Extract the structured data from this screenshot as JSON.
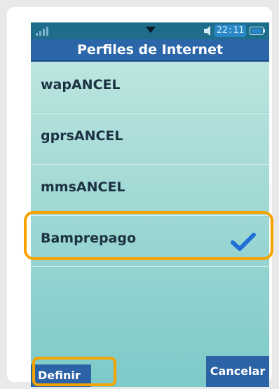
{
  "status_bar": {
    "time": "22:11",
    "icons": [
      "signal-icon",
      "chevron-down-icon",
      "volume-icon",
      "battery-icon"
    ]
  },
  "header": {
    "title": "Perfiles de Internet"
  },
  "profiles": [
    {
      "label": "wapANCEL",
      "selected": false
    },
    {
      "label": "gprsANCEL",
      "selected": false
    },
    {
      "label": "mmsANCEL",
      "selected": false
    },
    {
      "label": "Bamprepago",
      "selected": true
    }
  ],
  "softkeys": {
    "left_label": "Definir",
    "right_label": "Cancelar"
  },
  "colors": {
    "title_bar": "#2a66a8",
    "list_bg": "#c3e8e2",
    "highlight": "#f4a300",
    "check": "#1f6fd6"
  }
}
